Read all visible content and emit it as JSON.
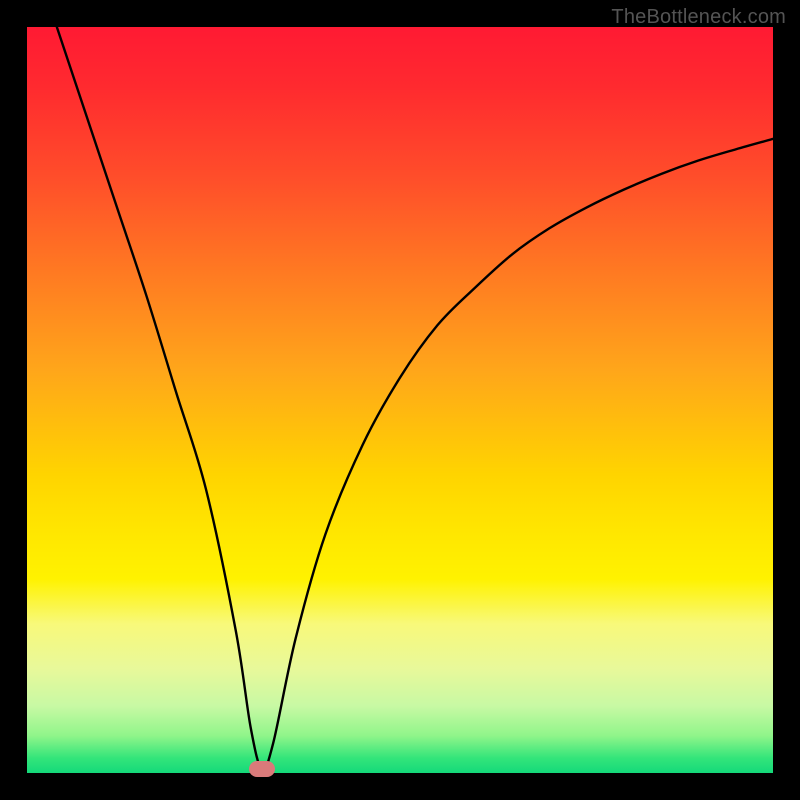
{
  "attribution": "TheBottleneck.com",
  "chart_data": {
    "type": "line",
    "title": "",
    "xlabel": "",
    "ylabel": "",
    "xlim": [
      0,
      100
    ],
    "ylim": [
      0,
      100
    ],
    "grid": false,
    "series": [
      {
        "name": "curve",
        "x": [
          4,
          8,
          12,
          16,
          20,
          24,
          28,
          30,
          31.5,
          33,
          36,
          40,
          45,
          50,
          55,
          60,
          65,
          70,
          75,
          80,
          85,
          90,
          95,
          100
        ],
        "y": [
          100,
          88,
          76,
          64,
          51,
          38,
          19,
          6,
          0.5,
          4,
          18,
          32,
          44,
          53,
          60,
          65,
          69.5,
          73,
          75.8,
          78.2,
          80.3,
          82.1,
          83.6,
          85
        ]
      }
    ],
    "marker": {
      "x": 31.5,
      "y": 0.5,
      "color": "#d97a7a"
    },
    "background_gradient": {
      "top": "#ff1a33",
      "mid": "#ffe700",
      "bottom": "#14d97a"
    }
  }
}
